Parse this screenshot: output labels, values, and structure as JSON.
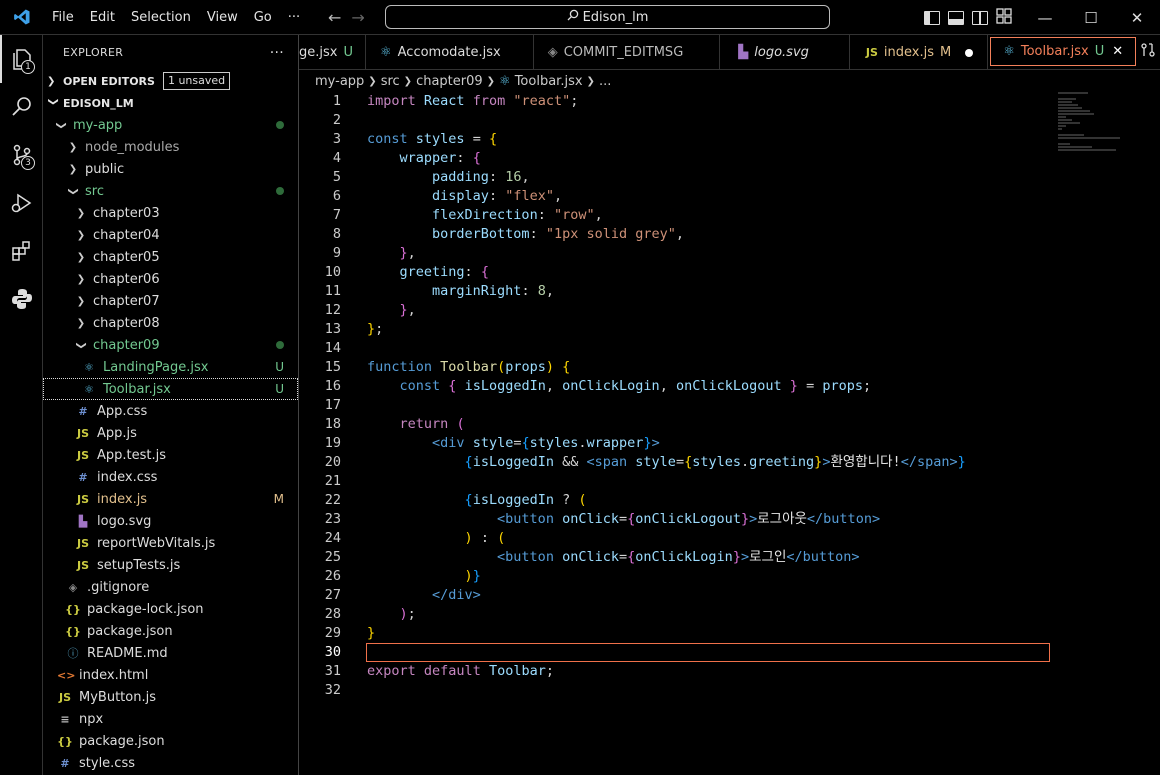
{
  "titlebar": {
    "menu": [
      "File",
      "Edit",
      "Selection",
      "View",
      "Go",
      "···"
    ],
    "search": "Edison_lm"
  },
  "activity": {
    "explorer_badge": "1",
    "scm_badge": "3"
  },
  "sidebar": {
    "header": "EXPLORER",
    "more": "···",
    "open_editors": "OPEN EDITORS",
    "unsaved": "1 unsaved",
    "root": "EDISON_LM",
    "items": [
      {
        "label": "my-app",
        "status": ""
      },
      {
        "label": "node_modules",
        "status": ""
      },
      {
        "label": "public",
        "status": ""
      },
      {
        "label": "src",
        "status": ""
      },
      {
        "label": "chapter03",
        "status": ""
      },
      {
        "label": "chapter04",
        "status": ""
      },
      {
        "label": "chapter05",
        "status": ""
      },
      {
        "label": "chapter06",
        "status": ""
      },
      {
        "label": "chapter07",
        "status": ""
      },
      {
        "label": "chapter08",
        "status": ""
      },
      {
        "label": "chapter09",
        "status": ""
      },
      {
        "label": "LandingPage.jsx",
        "status": "U"
      },
      {
        "label": "Toolbar.jsx",
        "status": "U"
      },
      {
        "label": "App.css",
        "status": ""
      },
      {
        "label": "App.js",
        "status": ""
      },
      {
        "label": "App.test.js",
        "status": ""
      },
      {
        "label": "index.css",
        "status": ""
      },
      {
        "label": "index.js",
        "status": "M"
      },
      {
        "label": "logo.svg",
        "status": ""
      },
      {
        "label": "reportWebVitals.js",
        "status": ""
      },
      {
        "label": "setupTests.js",
        "status": ""
      },
      {
        "label": ".gitignore",
        "status": ""
      },
      {
        "label": "package-lock.json",
        "status": ""
      },
      {
        "label": "package.json",
        "status": ""
      },
      {
        "label": "README.md",
        "status": ""
      },
      {
        "label": "index.html",
        "status": ""
      },
      {
        "label": "MyButton.js",
        "status": ""
      },
      {
        "label": "npx",
        "status": ""
      },
      {
        "label": "package.json",
        "status": ""
      },
      {
        "label": "style.css",
        "status": ""
      }
    ]
  },
  "tabs": [
    {
      "label": "ge.jsx",
      "status": "U"
    },
    {
      "label": "Accomodate.jsx",
      "status": ""
    },
    {
      "label": "COMMIT_EDITMSG",
      "status": ""
    },
    {
      "label": "logo.svg",
      "status": ""
    },
    {
      "label": "index.js",
      "status": "M"
    },
    {
      "label": "Toolbar.jsx",
      "status": "U"
    }
  ],
  "breadcrumb": [
    "my-app",
    "src",
    "chapter09",
    "Toolbar.jsx",
    "..."
  ],
  "editor": {
    "line_numbers": [
      "1",
      "2",
      "3",
      "4",
      "5",
      "6",
      "7",
      "8",
      "9",
      "10",
      "11",
      "12",
      "13",
      "14",
      "15",
      "16",
      "17",
      "18",
      "19",
      "20",
      "21",
      "22",
      "23",
      "24",
      "25",
      "26",
      "27",
      "28",
      "29",
      "30",
      "31",
      "32"
    ],
    "strings": {
      "react": "\"react\"",
      "flex": "\"flex\"",
      "row": "\"row\"",
      "border": "\"1px solid grey\"",
      "welcome": "환영합니다!",
      "logout": "로그아웃",
      "login": "로그인"
    },
    "numbers": {
      "padding": "16",
      "margin": "8"
    }
  }
}
